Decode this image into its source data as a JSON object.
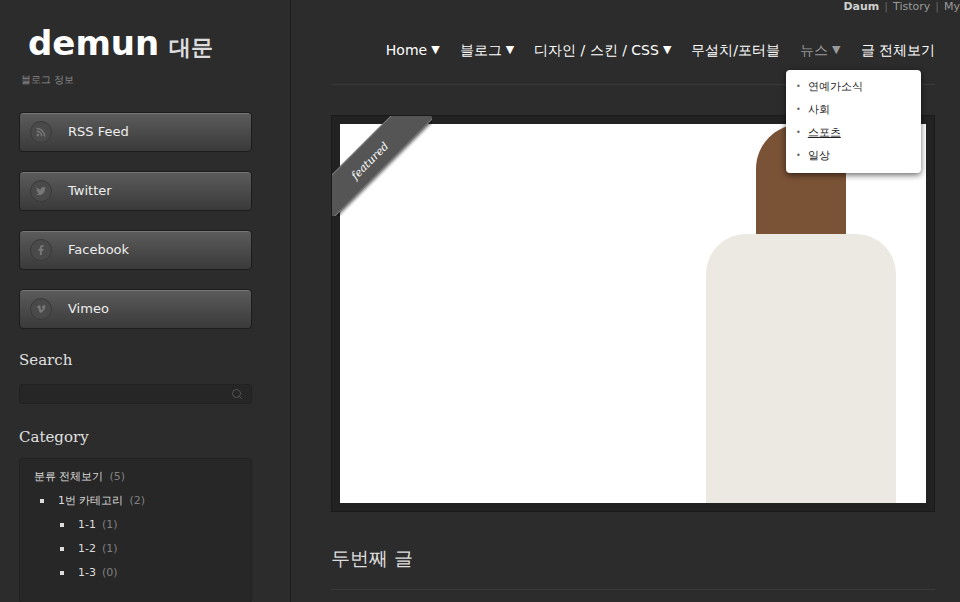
{
  "logo": {
    "title": "demun",
    "subtitle": "대문",
    "tagline": "블로그 정보"
  },
  "top_links": [
    {
      "label": "Daum",
      "bold": true
    },
    {
      "label": "Tistory",
      "bold": false
    },
    {
      "label": "My",
      "bold": false
    }
  ],
  "top_link_separator": "|",
  "nav": {
    "arrow": "▼",
    "items": [
      {
        "label": "Home",
        "has_menu": true,
        "hovered": false
      },
      {
        "label": "블로그",
        "has_menu": true,
        "hovered": false
      },
      {
        "label": "디자인 / 스킨 / CSS",
        "has_menu": true,
        "hovered": false
      },
      {
        "label": "무설치/포터블",
        "has_menu": false,
        "hovered": false
      },
      {
        "label": "뉴스",
        "has_menu": true,
        "hovered": true
      },
      {
        "label": "글 전체보기",
        "has_menu": false,
        "hovered": false
      }
    ]
  },
  "dropdown": {
    "bullet": "•",
    "items": [
      {
        "label": "연예가소식",
        "hovered": false
      },
      {
        "label": "사회",
        "hovered": false
      },
      {
        "label": "스포츠",
        "hovered": true
      },
      {
        "label": "일상",
        "hovered": false
      }
    ]
  },
  "social_buttons": [
    {
      "label": "RSS Feed",
      "kind": "rss"
    },
    {
      "label": "Twitter",
      "kind": "twitter"
    },
    {
      "label": "Facebook",
      "kind": "facebook"
    },
    {
      "label": "Vimeo",
      "kind": "vimeo"
    }
  ],
  "search": {
    "title": "Search",
    "placeholder": ""
  },
  "category": {
    "title": "Category",
    "items": [
      {
        "label": "분류 전체보기",
        "count": "(5)",
        "depth": 0
      },
      {
        "label": "1번 카테고리",
        "count": "(2)",
        "depth": 1
      },
      {
        "label": "1-1",
        "count": "(1)",
        "depth": 2
      },
      {
        "label": "1-2",
        "count": "(1)",
        "depth": 2
      },
      {
        "label": "1-3",
        "count": "(0)",
        "depth": 2
      }
    ]
  },
  "featured": {
    "ribbon": "featured"
  },
  "post": {
    "title": "두번째 글"
  }
}
